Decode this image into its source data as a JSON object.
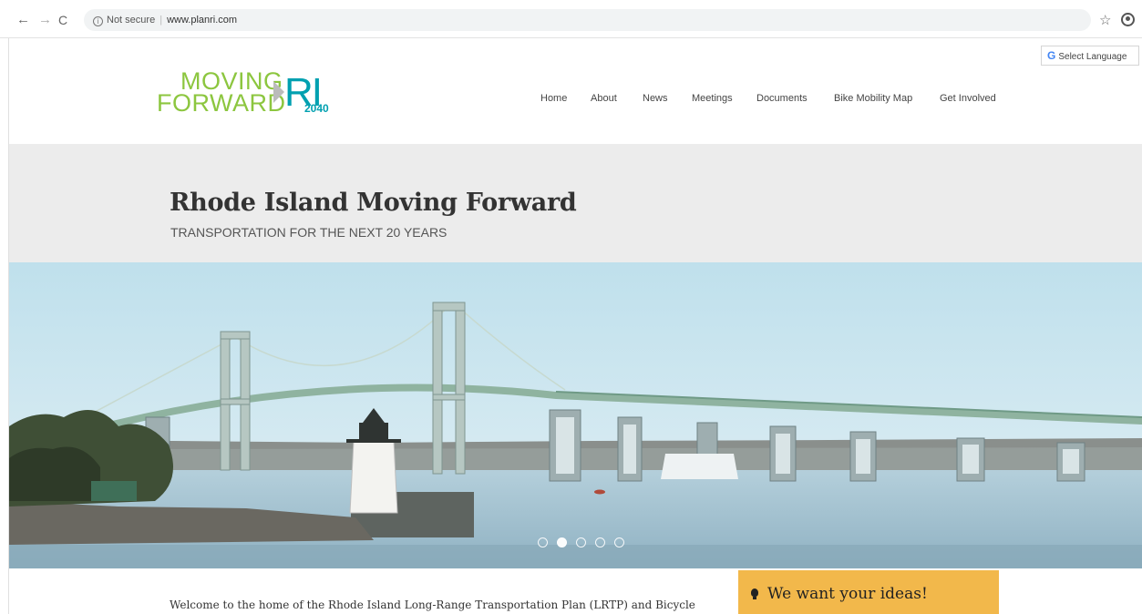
{
  "browser": {
    "back_icon": "←",
    "forward_icon": "→",
    "reload_icon": "C",
    "security_label": "Not secure",
    "url": "www.planri.com",
    "star_icon": "☆"
  },
  "translate": {
    "g_letter": "G",
    "label": "Select Language"
  },
  "logo": {
    "line1": "MOVING",
    "line2": "FORWARD",
    "ri": "RI",
    "year": "2040"
  },
  "nav": {
    "items": [
      {
        "label": "Home"
      },
      {
        "label": "About"
      },
      {
        "label": "News"
      },
      {
        "label": "Meetings"
      },
      {
        "label": "Documents"
      },
      {
        "label": "Bike Mobility Map"
      },
      {
        "label": "Get Involved"
      }
    ]
  },
  "hero": {
    "title": "Rhode Island Moving Forward",
    "subtitle": "TRANSPORTATION FOR THE NEXT 20 YEARS"
  },
  "slider": {
    "slide_count": 5,
    "active_index": 1
  },
  "welcome": {
    "text": "Welcome to the home of the Rhode Island Long-Range Transportation Plan (LRTP) and Bicycle"
  },
  "ideas": {
    "label": "We want your ideas!",
    "color": "#f2b84b",
    "icon": "lightbulb-icon"
  },
  "colors": {
    "logo_green": "#8cc63f",
    "logo_teal": "#00a0b0",
    "band": "#ececec"
  }
}
